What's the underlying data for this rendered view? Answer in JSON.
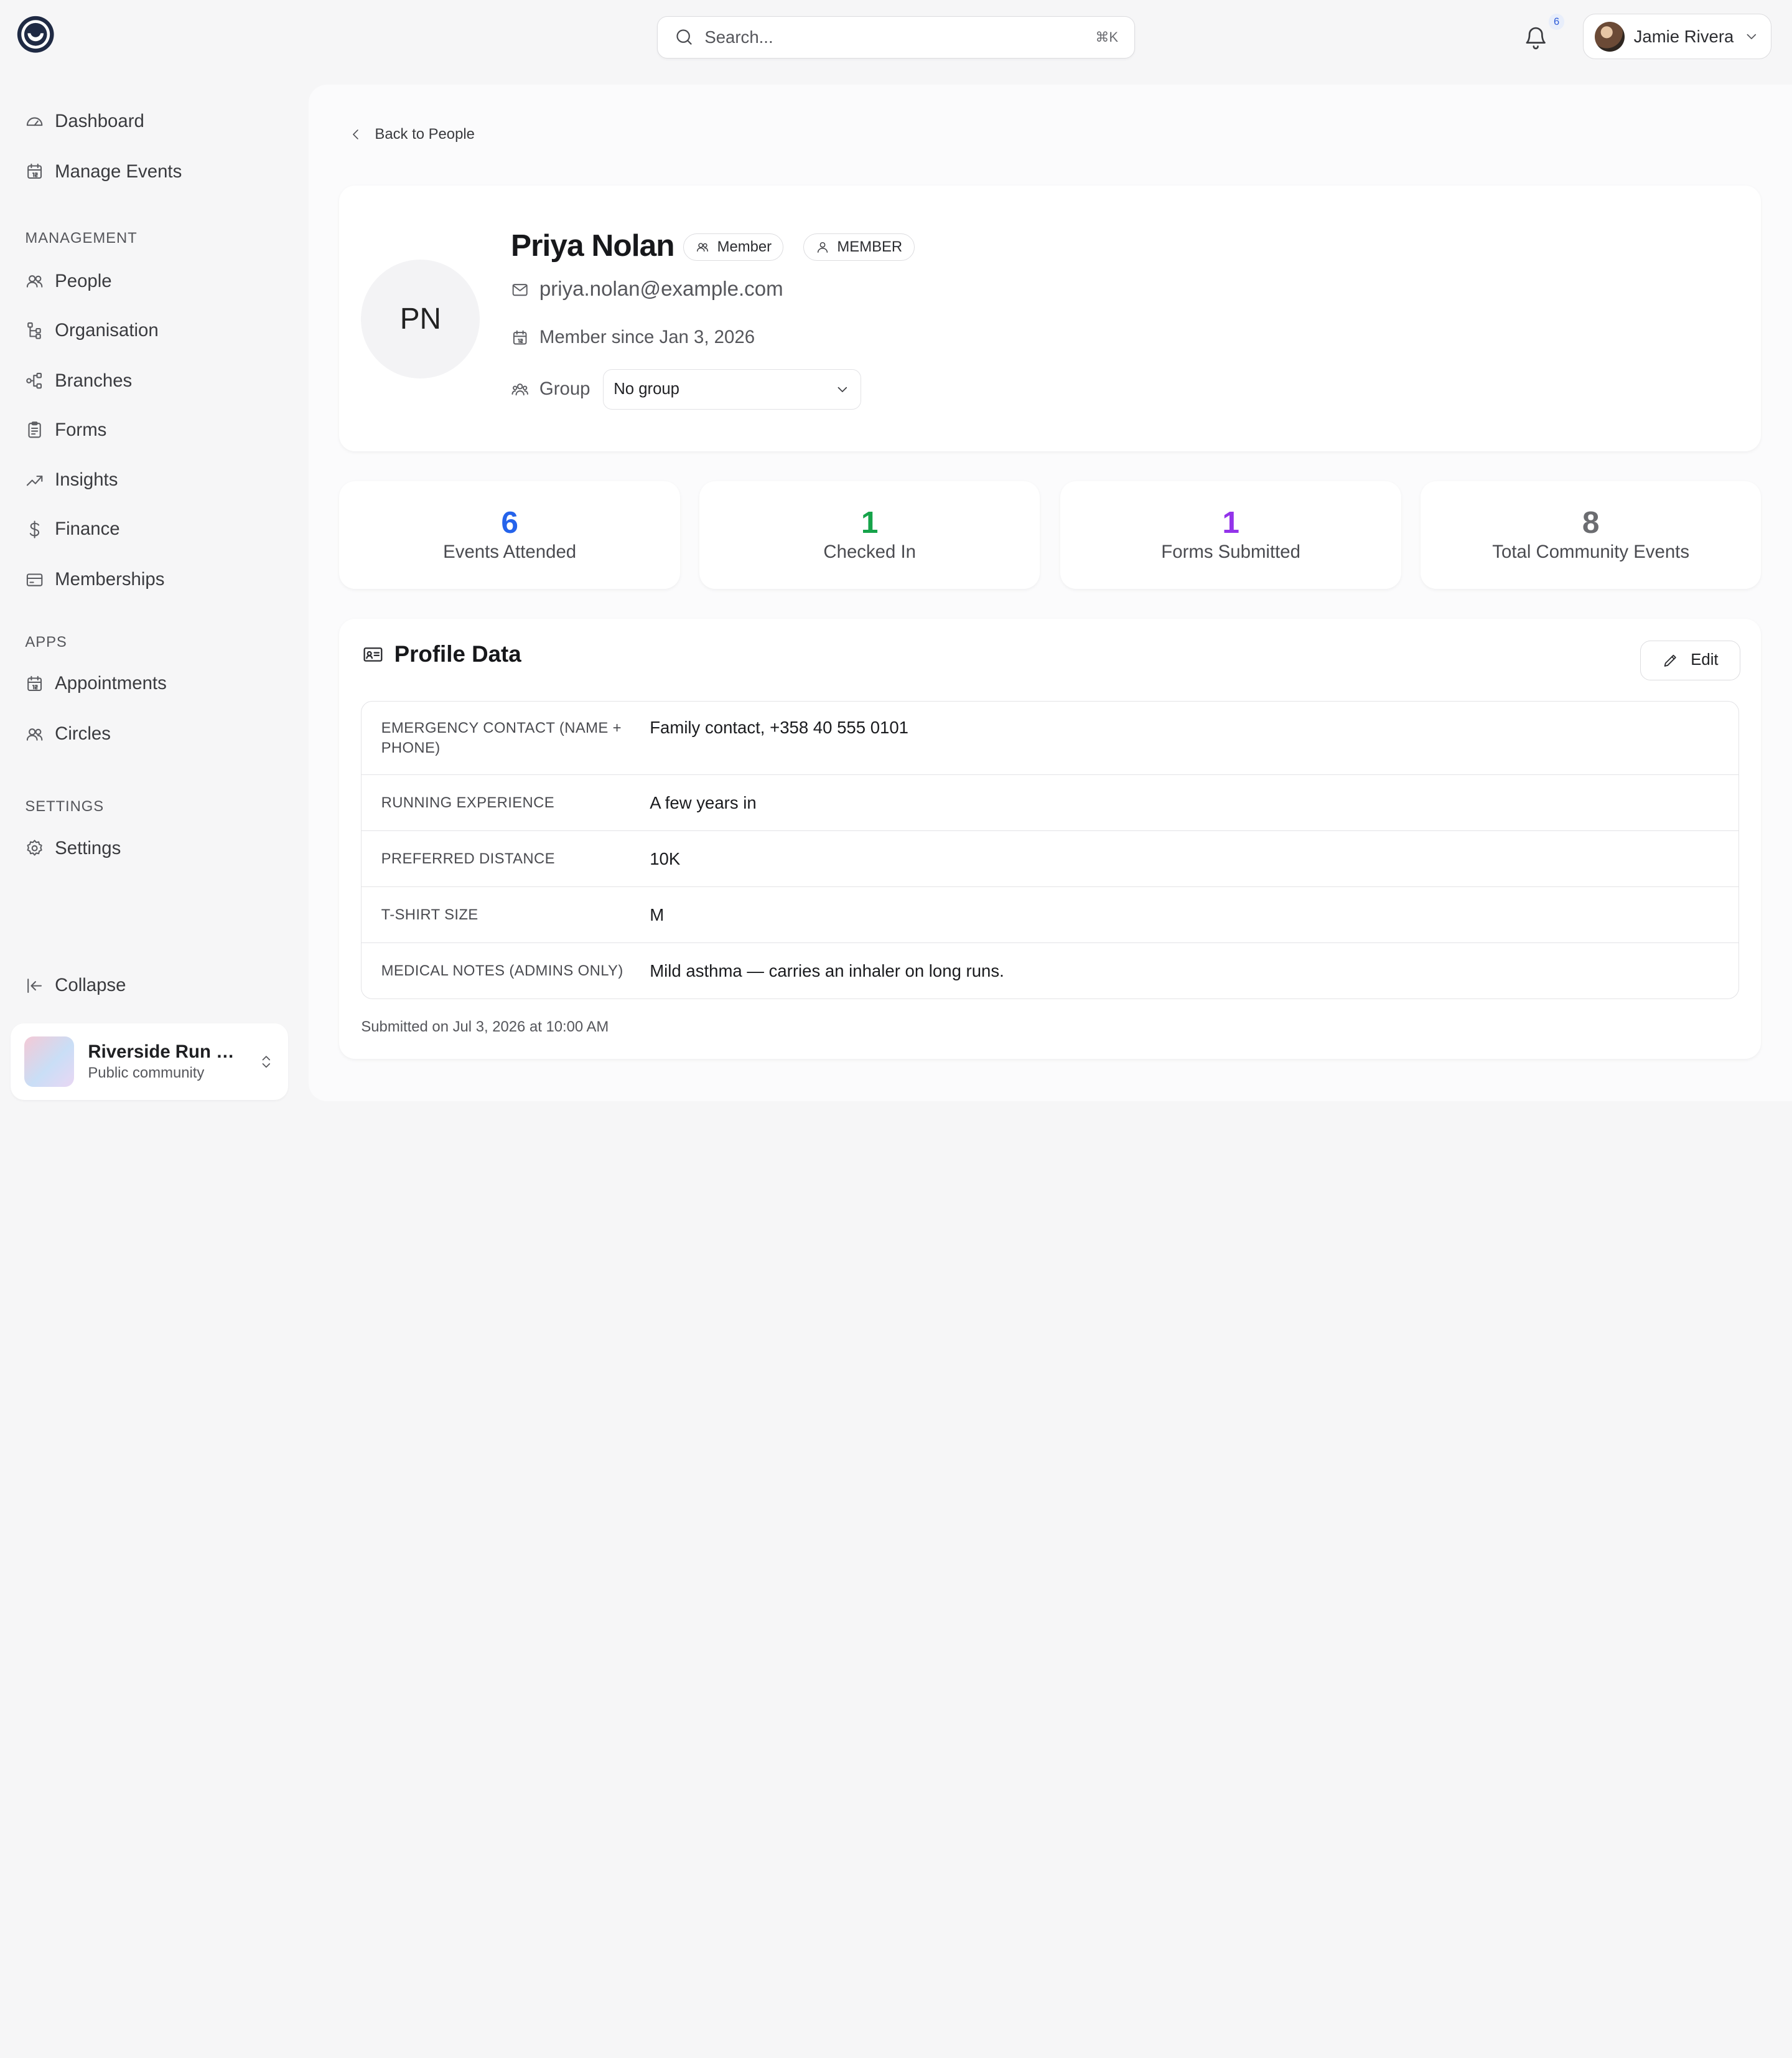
{
  "header": {
    "search_placeholder": "Search...",
    "search_shortcut": "⌘K",
    "notification_count": "6",
    "user_name": "Jamie Rivera"
  },
  "sidebar": {
    "top_items": [
      {
        "label": "Dashboard",
        "icon": "gauge-icon"
      },
      {
        "label": "Manage Events",
        "icon": "calendar-icon"
      }
    ],
    "management_heading": "MANAGEMENT",
    "management_items": [
      {
        "label": "People",
        "icon": "users-icon"
      },
      {
        "label": "Organisation",
        "icon": "hierarchy-icon"
      },
      {
        "label": "Branches",
        "icon": "branches-icon"
      },
      {
        "label": "Forms",
        "icon": "clipboard-icon"
      },
      {
        "label": "Insights",
        "icon": "trend-up-icon"
      },
      {
        "label": "Finance",
        "icon": "dollar-icon"
      },
      {
        "label": "Memberships",
        "icon": "card-icon"
      }
    ],
    "apps_heading": "APPS",
    "apps_items": [
      {
        "label": "Appointments",
        "icon": "calendar-icon"
      },
      {
        "label": "Circles",
        "icon": "users-icon"
      }
    ],
    "settings_heading": "SETTINGS",
    "settings_items": [
      {
        "label": "Settings",
        "icon": "gear-icon"
      }
    ],
    "collapse_label": "Collapse",
    "community": {
      "name": "Riverside Run Club",
      "type": "Public community"
    }
  },
  "main": {
    "back_label": "Back to People",
    "profile": {
      "initials": "PN",
      "name": "Priya Nolan",
      "role_badge": "Member",
      "type_badge": "MEMBER",
      "email": "priya.nolan@example.com",
      "member_since": "Member since Jan 3, 2026",
      "group_label": "Group",
      "group_value": "No group"
    },
    "stats": [
      {
        "value": "6",
        "label": "Events Attended",
        "color": "#2563eb"
      },
      {
        "value": "1",
        "label": "Checked In",
        "color": "#16a34a"
      },
      {
        "value": "1",
        "label": "Forms Submitted",
        "color": "#9333ea"
      },
      {
        "value": "8",
        "label": "Total Community Events",
        "color": "#6b6c70"
      }
    ],
    "profile_data": {
      "title": "Profile Data",
      "edit_label": "Edit",
      "rows": [
        {
          "key": "EMERGENCY CONTACT (NAME + PHONE)",
          "value": "Family contact, +358 40 555 0101"
        },
        {
          "key": "RUNNING EXPERIENCE",
          "value": "A few years in"
        },
        {
          "key": "PREFERRED DISTANCE",
          "value": "10K"
        },
        {
          "key": "T-SHIRT SIZE",
          "value": "M"
        },
        {
          "key": "MEDICAL NOTES (ADMINS ONLY)",
          "value": "Mild asthma — carries an inhaler on long runs."
        }
      ],
      "submitted": "Submitted on Jul 3, 2026 at 10:00 AM"
    }
  }
}
